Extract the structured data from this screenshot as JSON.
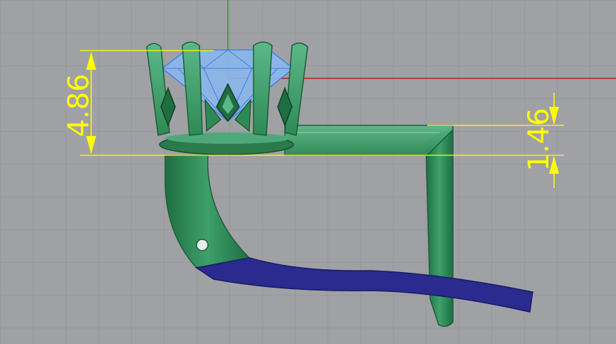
{
  "viewport": {
    "background": "#a0a1a4",
    "grid_color": "#8d8e91",
    "axis_x_color": "#b51f1f",
    "axis_y_color": "#2f9a2f"
  },
  "model": {
    "band_color": "#2e8a55",
    "band_highlight": "#7dc9a0",
    "selected_color": "#2a2a8f",
    "gem_color": "#7fb2f0",
    "gem_edge": "#3d7fe6"
  },
  "dimensions": {
    "color": "#ffff00",
    "height_label": "4.86",
    "thickness_label": "1.46"
  }
}
